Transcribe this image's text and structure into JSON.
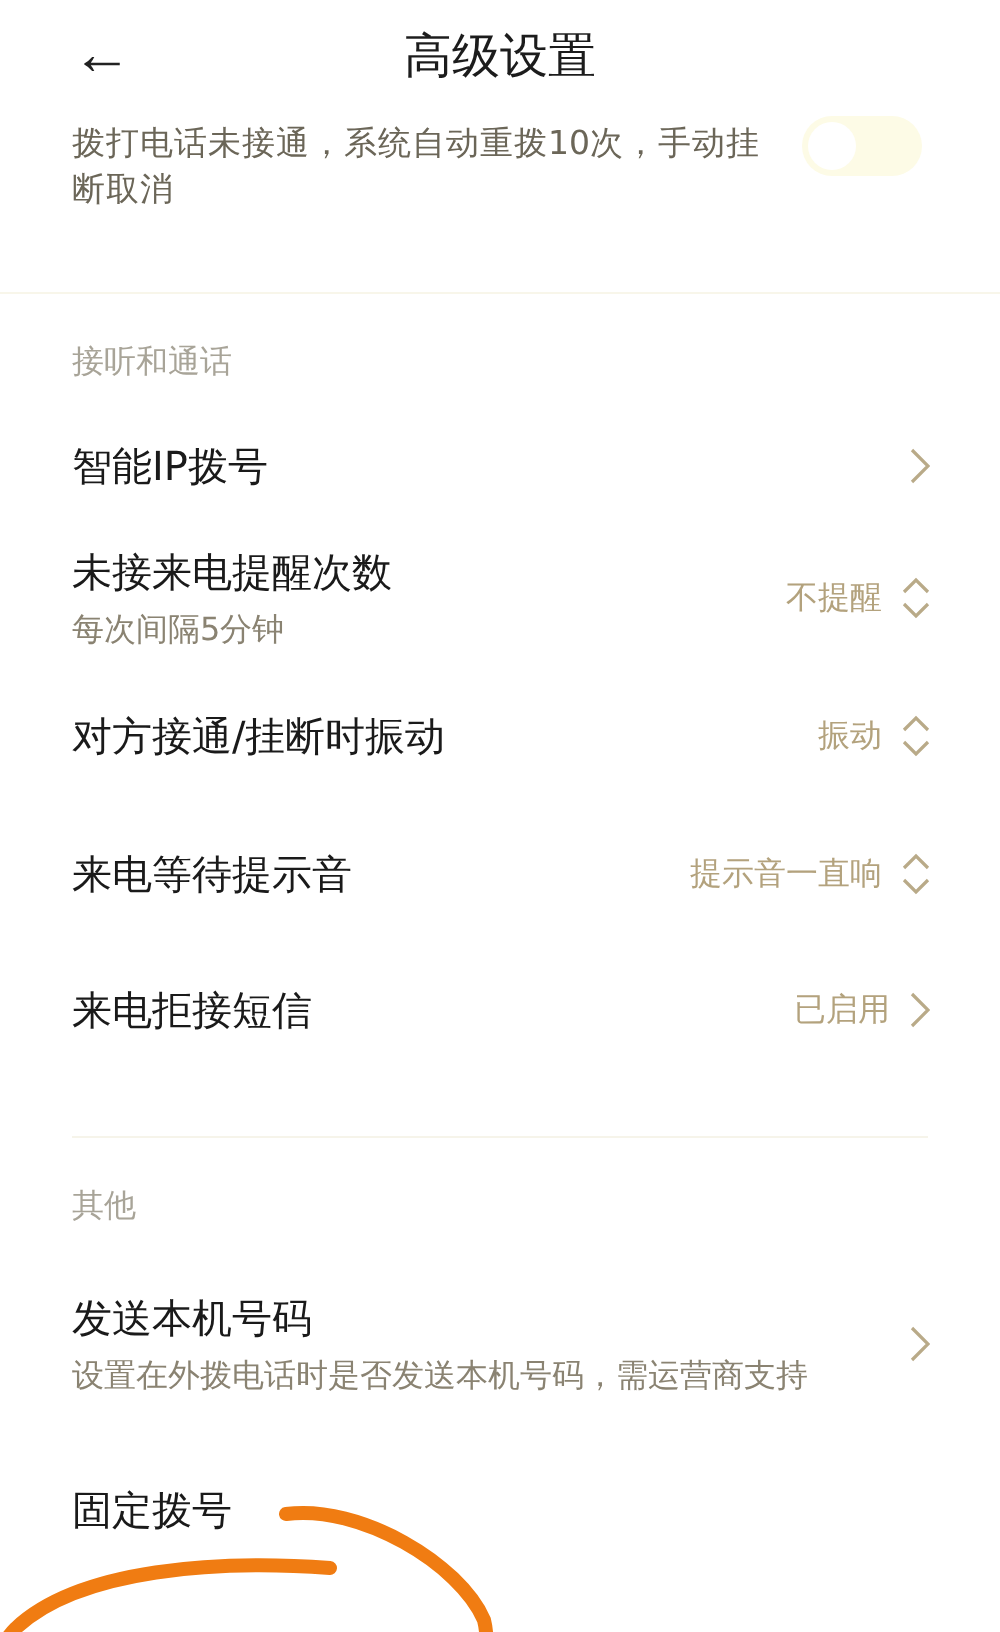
{
  "header": {
    "back": "←",
    "title": "高级设置"
  },
  "auto_redial": {
    "description": "拨打电话未接通，系统自动重拨10次，手动挂断取消",
    "on": false
  },
  "sections": [
    {
      "title": "接听和通话",
      "items": [
        {
          "label": "智能IP拨号",
          "kind": "link"
        },
        {
          "label": "未接来电提醒次数",
          "subtitle": "每次间隔5分钟",
          "value": "不提醒",
          "kind": "select"
        },
        {
          "label": "对方接通/挂断时振动",
          "value": "振动",
          "kind": "select"
        },
        {
          "label": "来电等待提示音",
          "value": "提示音一直响",
          "kind": "select"
        },
        {
          "label": "来电拒接短信",
          "value": "已启用",
          "kind": "link"
        }
      ]
    },
    {
      "title": "其他",
      "items": [
        {
          "label": "发送本机号码",
          "subtitle": "设置在外拨电话时是否发送本机号码，需运营商支持",
          "kind": "link"
        },
        {
          "label": "固定拨号",
          "kind": "plain"
        }
      ]
    }
  ]
}
